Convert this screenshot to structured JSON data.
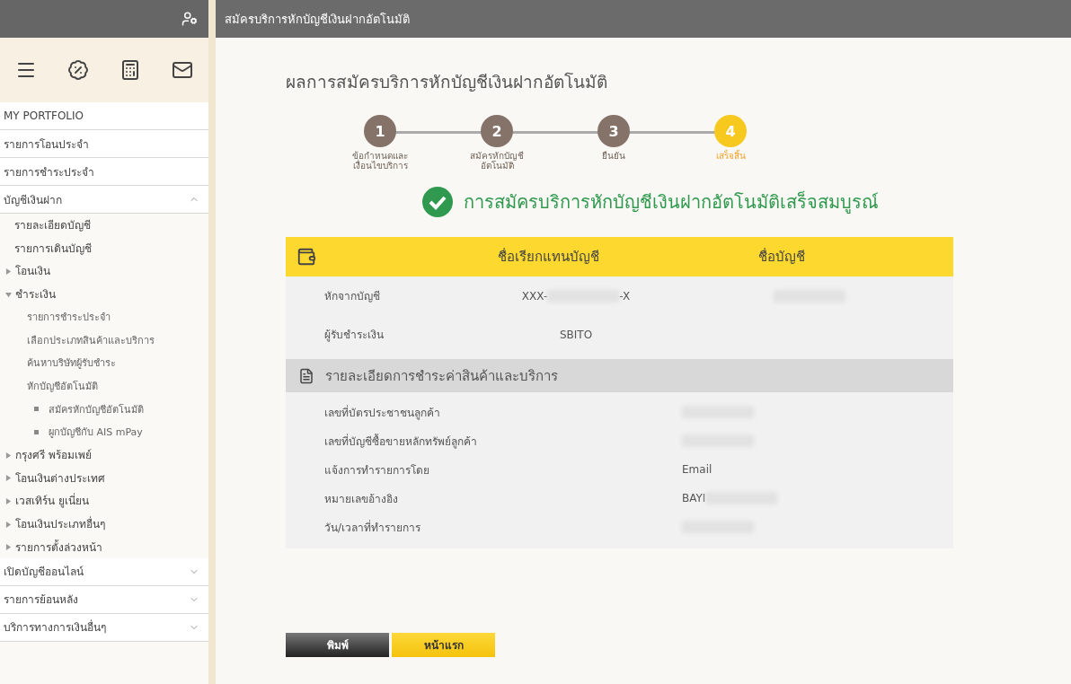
{
  "header": {
    "title": "สมัครบริการหักบัญชีเงินฝากอัตโนมัติ"
  },
  "sidebar": {
    "menu": [
      {
        "label": "MY PORTFOLIO"
      },
      {
        "label": "รายการโอนประจำ"
      },
      {
        "label": "รายการชำระประจำ"
      },
      {
        "label": "บัญชีเงินฝาก",
        "expanded": true,
        "children": [
          {
            "label": "รายละเอียดบัญชี"
          },
          {
            "label": "รายการเดินบัญชี"
          },
          {
            "label": "โอนเงิน",
            "expanded": false
          },
          {
            "label": "ชำระเงิน",
            "expanded": true,
            "children": [
              {
                "label": "รายการชำระประจำ"
              },
              {
                "label": "เลือกประเภทสินค้าและบริการ"
              },
              {
                "label": "ค้นหาบริษัทผู้รับชำระ"
              },
              {
                "label": "หักบัญชีอัตโนมัติ",
                "children": [
                  {
                    "label": "สมัครหักบัญชีอัตโนมัติ"
                  },
                  {
                    "label": "ผูกบัญชีกับ AIS mPay"
                  }
                ]
              }
            ]
          },
          {
            "label": "กรุงศรี พร้อมเพย์",
            "expanded": false
          },
          {
            "label": "โอนเงินต่างประเทศ",
            "expanded": false
          },
          {
            "label": "เวสเทิร์น ยูเนี่ยน",
            "expanded": false
          },
          {
            "label": "โอนเงินประเภทอื่นๆ",
            "expanded": false
          },
          {
            "label": "รายการตั้งล่วงหน้า",
            "expanded": false
          }
        ]
      },
      {
        "label": "เปิดบัญชีออนไลน์",
        "expanded": false
      },
      {
        "label": "รายการย้อนหลัง",
        "expanded": false
      },
      {
        "label": "บริการทางการเงินอื่นๆ",
        "expanded": false
      }
    ]
  },
  "page": {
    "title": "ผลการสมัครบริการหักบัญชีเงินฝากอัตโนมัติ",
    "steps": [
      {
        "number": "1",
        "label_lines": [
          "ข้อกำหนดและ",
          "เงื่อนไขบริการ"
        ],
        "selected": false
      },
      {
        "number": "2",
        "label_lines": [
          "สมัครหักบัญชี",
          "อัตโนมัติ"
        ],
        "selected": false
      },
      {
        "number": "3",
        "label_lines": [
          "ยืนยัน"
        ],
        "selected": false
      },
      {
        "number": "4",
        "label_lines": [
          "เสร็จสิ้น"
        ],
        "selected": true
      }
    ],
    "result": {
      "success": true,
      "message": "การสมัครบริการหักบัญชีเงินฝากอัตโนมัติเสร็จสมบูรณ์"
    },
    "account_table": {
      "columns": [
        "ชื่อเรียกแทนบัญชี",
        "ชื่อบัญชี"
      ],
      "rows": [
        {
          "label": "หักจากบัญชี",
          "cells": [
            [
              {
                "kind": "text",
                "text": "XXX-"
              },
              {
                "kind": "blurred"
              },
              {
                "kind": "text",
                "text": "-X"
              }
            ],
            [
              {
                "kind": "blurred"
              }
            ]
          ]
        },
        {
          "label": "ผู้รับชำระเงิน",
          "cells": [
            [
              {
                "kind": "text",
                "text": "SBITO"
              }
            ],
            []
          ]
        }
      ]
    },
    "details": {
      "title": "รายละเอียดการชำระค่าสินค้าและบริการ",
      "rows": [
        {
          "label": "เลขที่บัตรประชาชนลูกค้า",
          "value": [
            {
              "kind": "blurred"
            }
          ]
        },
        {
          "label": "เลขที่บัญชีซื้อขายหลักทรัพย์ลูกค้า",
          "value": [
            {
              "kind": "blurred"
            }
          ]
        },
        {
          "label": "แจ้งการทำรายการโดย",
          "value": [
            {
              "kind": "text",
              "text": "Email"
            }
          ]
        },
        {
          "label": "หมายเลขอ้างอิง",
          "value": [
            {
              "kind": "text",
              "text": "BAYI"
            },
            {
              "kind": "blurred"
            }
          ]
        },
        {
          "label": "วัน/เวลาที่ทำรายการ",
          "value": [
            {
              "kind": "blurred"
            }
          ]
        }
      ]
    },
    "buttons": [
      {
        "label": "พิมพ์",
        "kind": "secondary"
      },
      {
        "label": "หน้าแรก",
        "kind": "primary"
      }
    ]
  }
}
